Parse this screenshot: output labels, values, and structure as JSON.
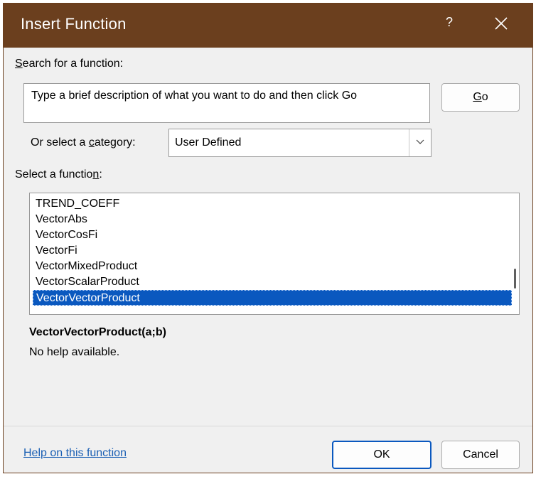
{
  "window": {
    "title": "Insert Function",
    "help_label": "?",
    "title_bar_color": "#6b3f1e",
    "icons": {
      "close": "close-icon",
      "dropdown": "chevron-down-icon"
    }
  },
  "search": {
    "label_pre": "",
    "label_acc": "S",
    "label_post": "earch for a function:",
    "value": "Type a brief description of what you want to do and then click Go",
    "go_pre": "",
    "go_acc": "G",
    "go_post": "o"
  },
  "category": {
    "label_pre": "Or select a ",
    "label_acc": "c",
    "label_post": "ategory:",
    "selected": "User Defined"
  },
  "functions": {
    "label_pre": "Select a functio",
    "label_acc": "n",
    "label_post": ":",
    "items": [
      "TREND_COEFF",
      "VectorAbs",
      "VectorCosFi",
      "VectorFi",
      "VectorMixedProduct",
      "VectorScalarProduct",
      "VectorVectorProduct"
    ],
    "selected_index": 6,
    "selection_color": "#0a58bf"
  },
  "details": {
    "signature": "VectorVectorProduct(a;b)",
    "help_text": "No help available."
  },
  "footer": {
    "help_link": "Help on this function",
    "ok": "OK",
    "cancel": "Cancel"
  }
}
